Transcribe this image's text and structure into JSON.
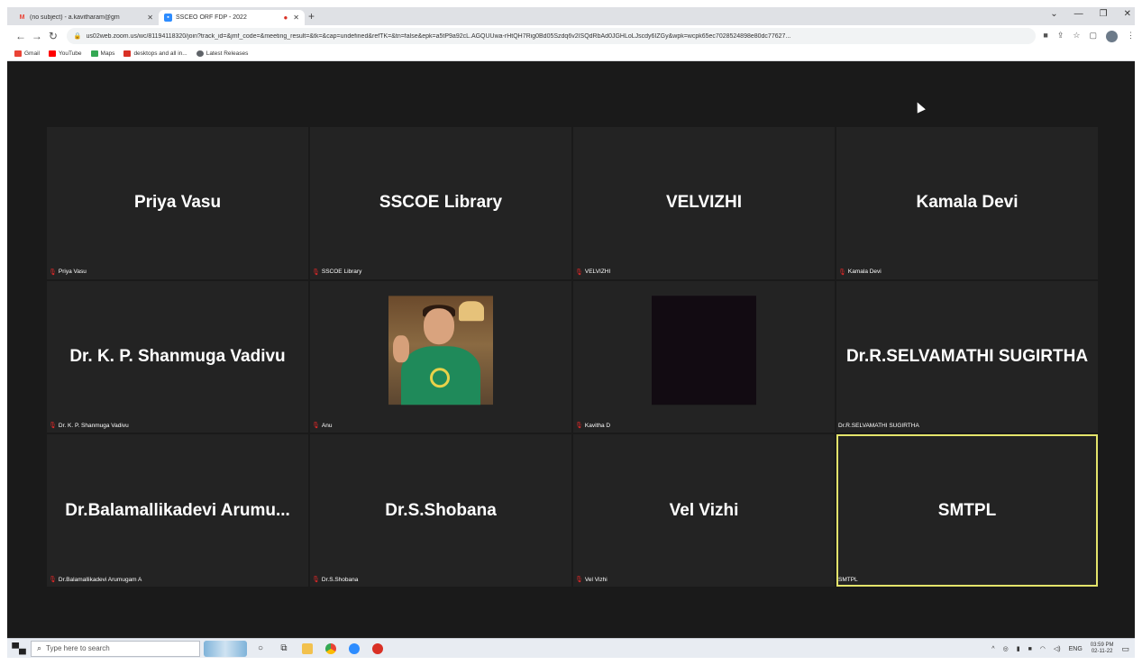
{
  "browser": {
    "tabs": [
      {
        "title": "(no subject) - a.kavitharam@gm",
        "active": false,
        "icon": "gmail-icon"
      },
      {
        "title": "SSCEO ORF FDP - 2022",
        "active": true,
        "icon": "zoom-icon"
      }
    ],
    "url": "us02web.zoom.us/wc/81194118320/join?track_id=&jmf_code=&meeting_result=&tk=&cap=undefined&refTK=&tn=false&epk=a5tP9a92cL.AGQUUwa-rHtQH7Rig0Bd05Szdq6v2ISQdRbAd0JGHLoLJscdy6IZGy&wpk=wcpk65ec7028524898e80dc77627...",
    "bookmarks": [
      {
        "label": "Gmail",
        "color": "#ea4335"
      },
      {
        "label": "YouTube",
        "color": "#ff0000"
      },
      {
        "label": "Maps",
        "color": "#34a853"
      },
      {
        "label": "desktops and all in...",
        "color": "#d93025"
      },
      {
        "label": "Latest Releases",
        "color": "#5f6368"
      }
    ]
  },
  "meeting": {
    "participants": [
      {
        "display_name": "Priya Vasu",
        "label": "Priya Vasu",
        "muted": true,
        "video": "name"
      },
      {
        "display_name": "SSCOE Library",
        "label": "SSCOE Library",
        "muted": true,
        "video": "name"
      },
      {
        "display_name": "VELVIZHI",
        "label": "VELVIZHI",
        "muted": true,
        "video": "name"
      },
      {
        "display_name": "Kamala Devi",
        "label": "Kamala Devi",
        "muted": true,
        "video": "name"
      },
      {
        "display_name": "Dr. K. P. Shanmuga Vadivu",
        "label": "Dr. K. P. Shanmuga Vadivu",
        "muted": true,
        "video": "name"
      },
      {
        "display_name": "",
        "label": "Anu",
        "muted": true,
        "video": "photo"
      },
      {
        "display_name": "",
        "label": "Kavitha D",
        "muted": true,
        "video": "black"
      },
      {
        "display_name": "Dr.R.SELVAMATHI SUGIRTHA",
        "label": "Dr.R.SELVAMATHI SUGIRTHA",
        "muted": false,
        "video": "name"
      },
      {
        "display_name": "Dr.Balamallikadevi Arumu...",
        "label": "Dr.Balamallikadevi Arumugam A",
        "muted": true,
        "video": "name"
      },
      {
        "display_name": "Dr.S.Shobana",
        "label": "Dr.S.Shobana",
        "muted": true,
        "video": "name"
      },
      {
        "display_name": "Vel Vizhi",
        "label": "Vel Vizhi",
        "muted": true,
        "video": "name"
      },
      {
        "display_name": "SMTPL",
        "label": "SMTPL",
        "muted": false,
        "video": "name",
        "active_speaker": true
      }
    ],
    "active_speaker_color": "#e4e46b"
  },
  "taskbar": {
    "search_placeholder": "Type here to search",
    "tray_lang": "ENG",
    "clock_time": "03:59 PM",
    "clock_date": "02-11-22"
  }
}
